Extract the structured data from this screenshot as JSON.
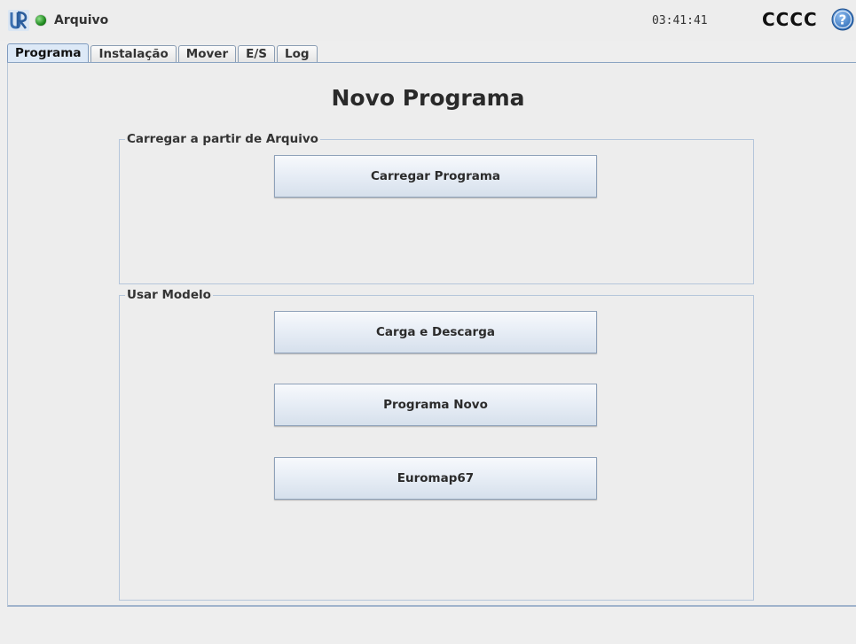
{
  "titlebar": {
    "app_title": "Arquivo",
    "clock": "03:41:41",
    "robot_name": "CCCC",
    "help_symbol": "?",
    "logo_icon": "ur-logo-icon",
    "status_icon": "status-dot-icon",
    "status_color": "#1f8a1f"
  },
  "tabs": [
    {
      "label": "Programa",
      "active": true
    },
    {
      "label": "Instalação",
      "active": false
    },
    {
      "label": "Mover",
      "active": false
    },
    {
      "label": "E/S",
      "active": false
    },
    {
      "label": "Log",
      "active": false
    }
  ],
  "main": {
    "title": "Novo Programa",
    "load_group": {
      "label": "Carregar a partir de Arquivo",
      "load_button": "Carregar Programa"
    },
    "template_group": {
      "label": "Usar Modelo",
      "buttons": [
        "Carga e Descarga",
        "Programa Novo",
        "Euromap67"
      ]
    }
  }
}
